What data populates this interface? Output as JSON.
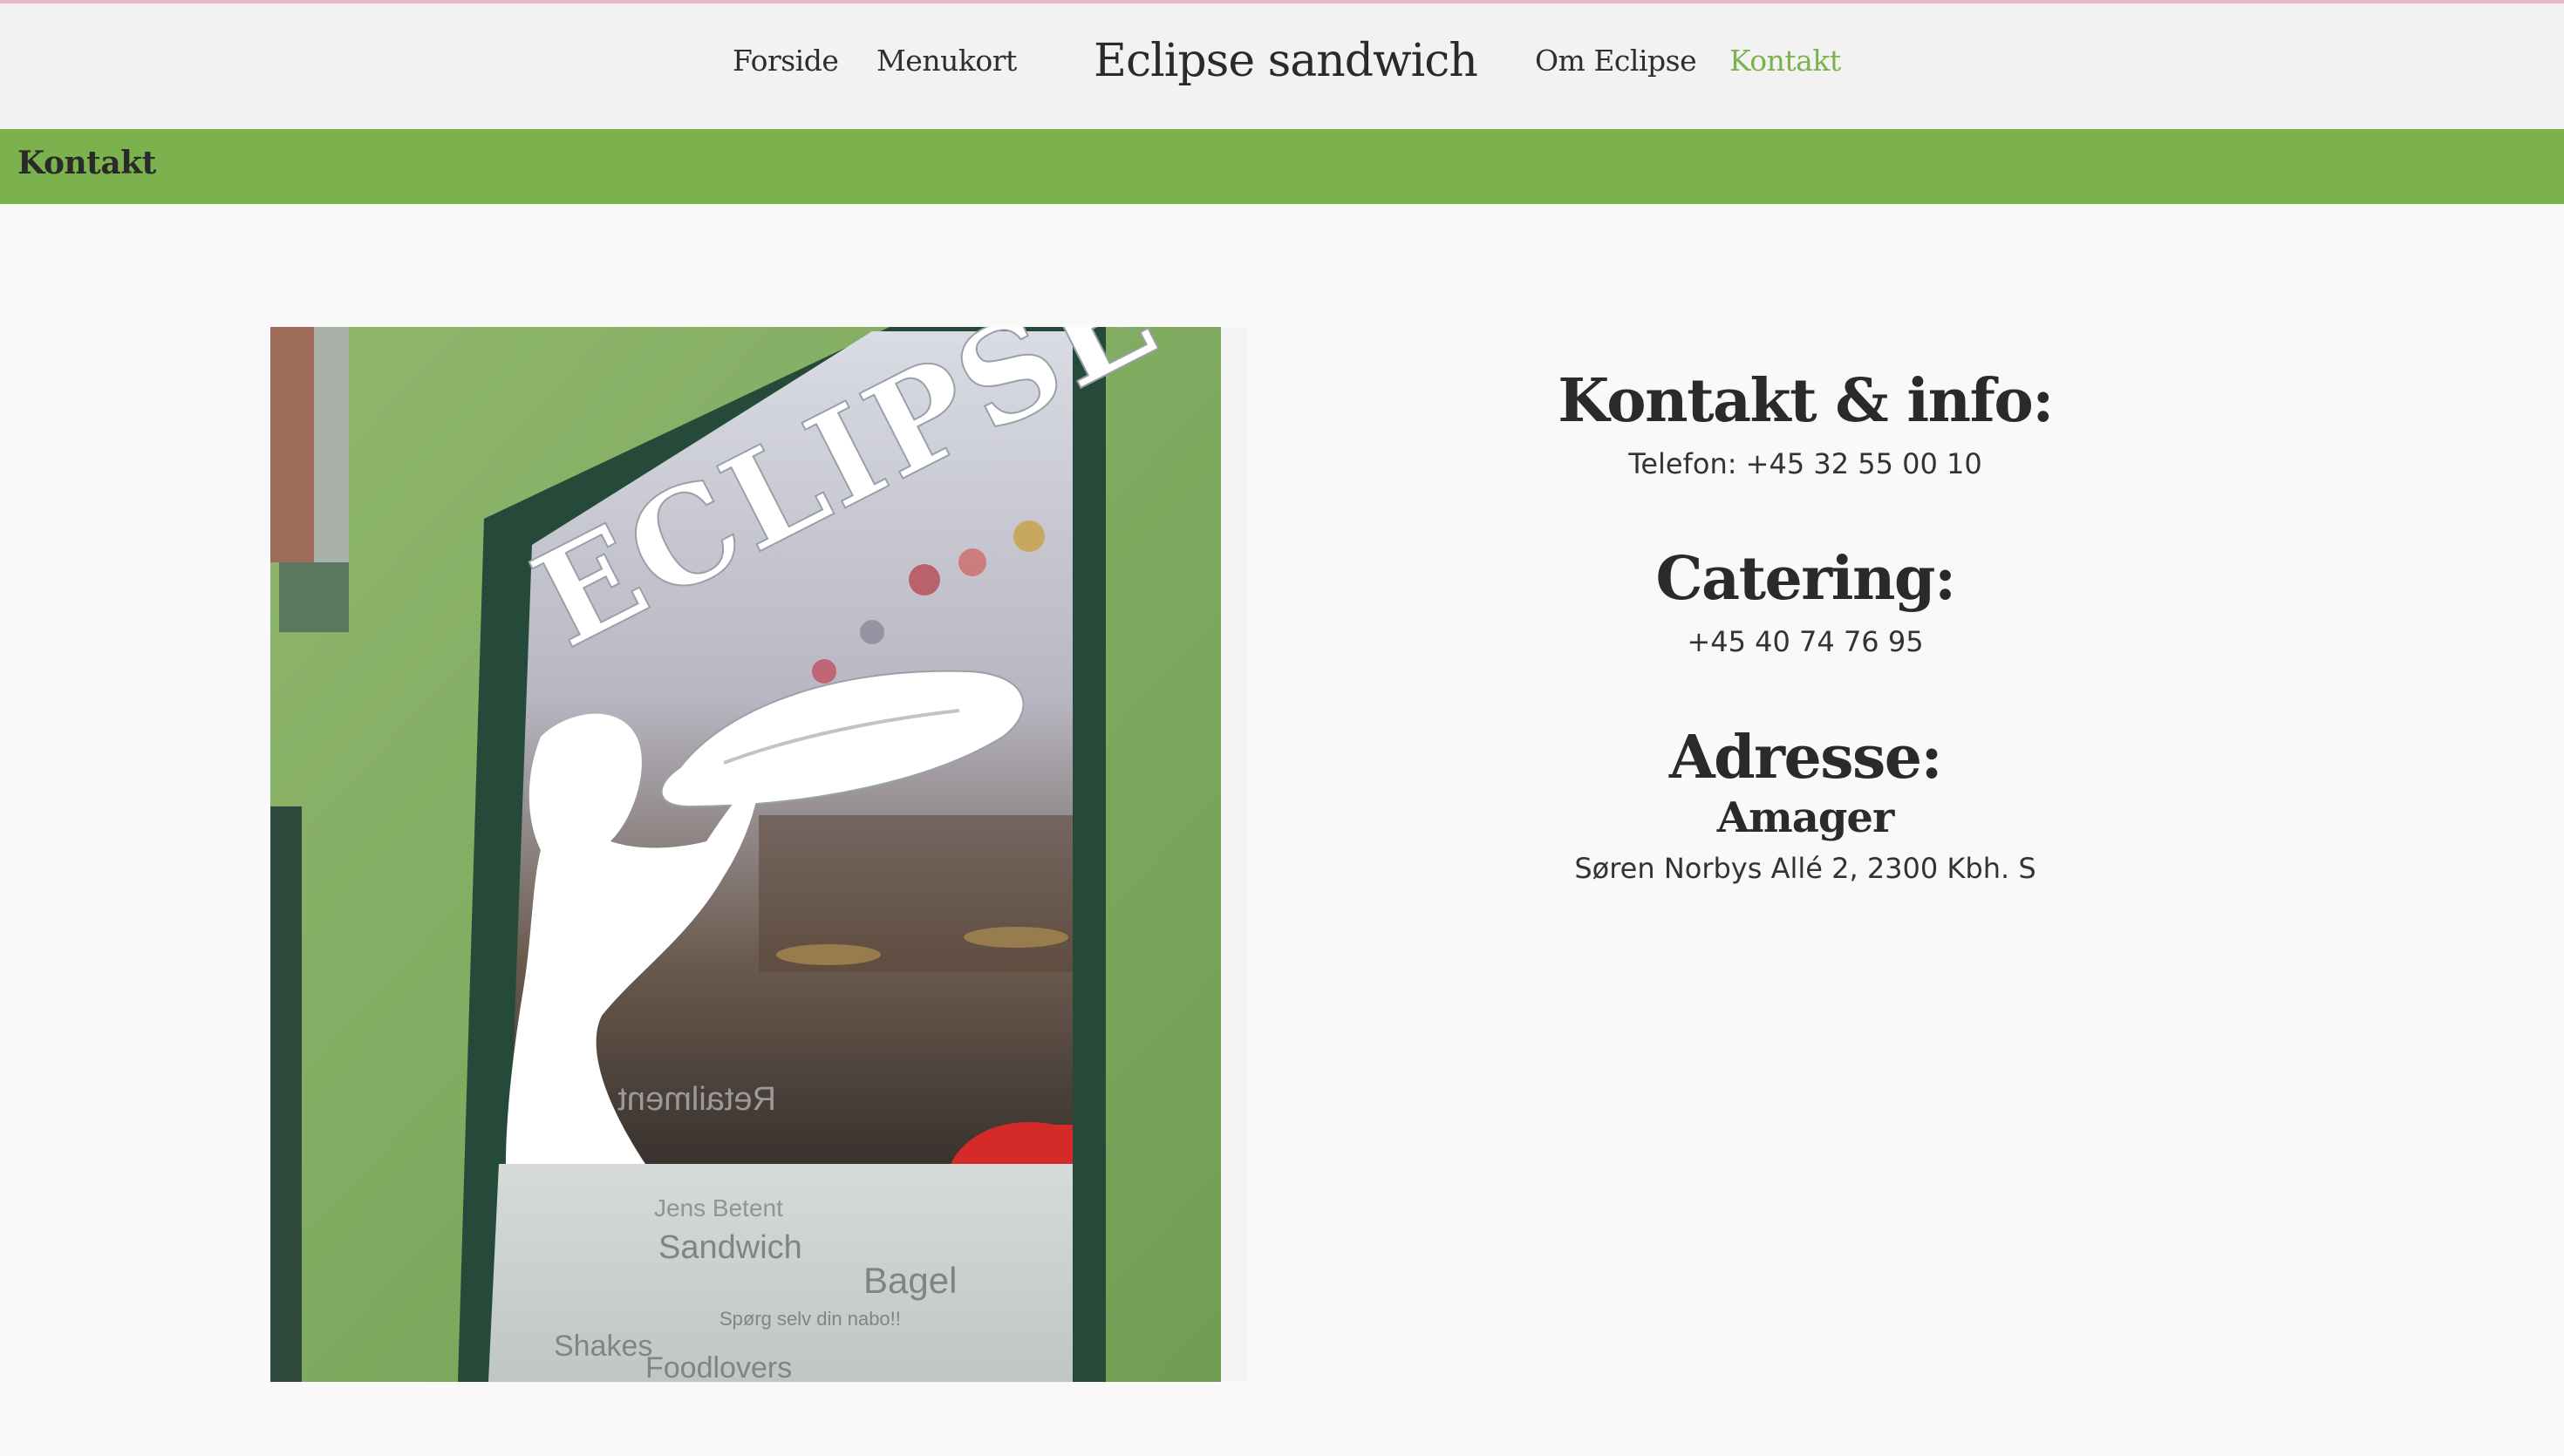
{
  "header": {
    "nav_left": [
      {
        "label": "Forside"
      },
      {
        "label": "Menukort"
      }
    ],
    "brand": "Eclipse sandwich",
    "nav_right": [
      {
        "label": "Om Eclipse"
      },
      {
        "label": "Kontakt",
        "active": true
      }
    ],
    "accent_color": "#7cb24e"
  },
  "banner": {
    "title": "Kontakt"
  },
  "photo": {
    "window_sign": "ECLIPSE",
    "window_words": [
      "Sandwich",
      "Bagel",
      "Shakes",
      "Foodlovers",
      "Jens Betent",
      "Spørg selv din nabo!!",
      "Retailment"
    ]
  },
  "contact": {
    "heading": "Kontakt & info:",
    "phone": "Telefon: +45 32 55 00 10"
  },
  "catering": {
    "heading": "Catering:",
    "phone": "+45 40 74 76 95"
  },
  "address": {
    "heading": "Adresse:",
    "location": "Amager",
    "street": "Søren Norbys Allé 2, 2300 Kbh. S"
  }
}
